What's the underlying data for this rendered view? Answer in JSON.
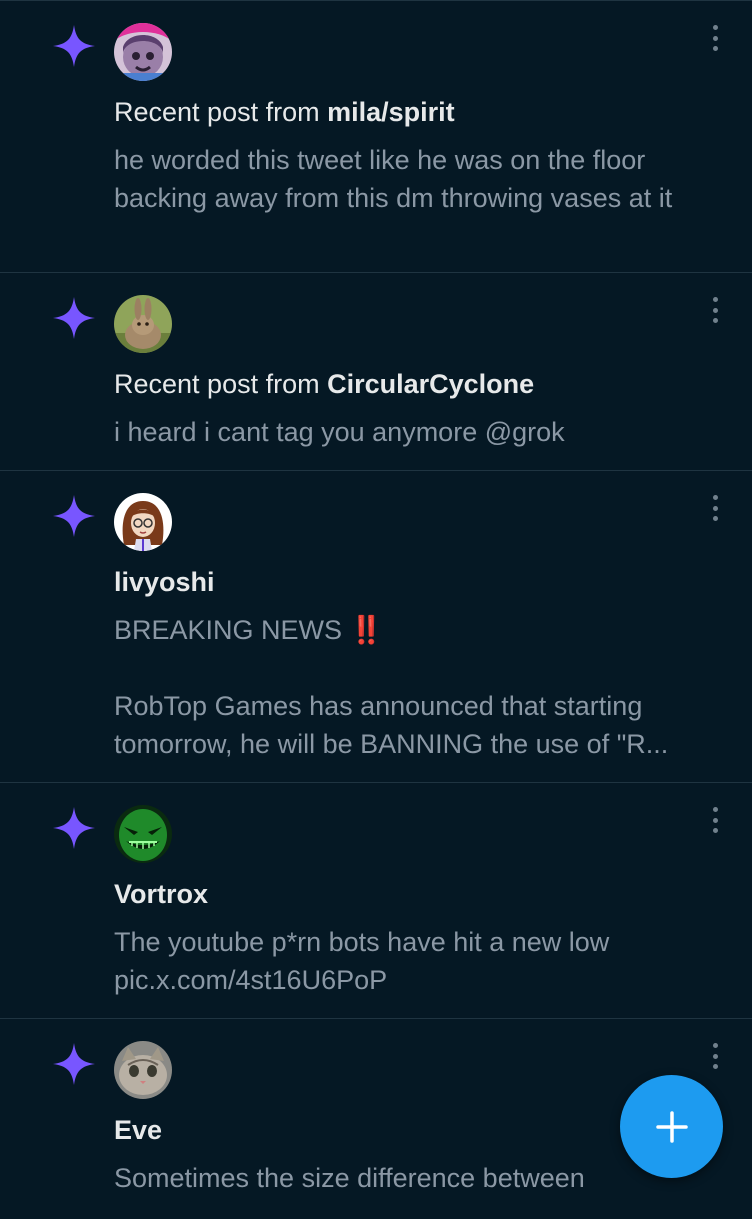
{
  "colors": {
    "background": "#051824",
    "sparkle": "#7856ff",
    "fab": "#1d9bf0",
    "body_text": "#8b98a5",
    "divider": "#1f3441"
  },
  "notifications": [
    {
      "type": "recent_post",
      "prefix": "Recent post from ",
      "author": "mila/spirit",
      "text": "he worded this tweet like he was on the floor backing away from this dm throwing vases at it",
      "avatar": "anime-avatar"
    },
    {
      "type": "recent_post",
      "prefix": "Recent post from ",
      "author": "CircularCyclone",
      "text": "i heard i cant tag you anymore @grok",
      "avatar": "rabbit-avatar"
    },
    {
      "type": "post",
      "author": "livyoshi",
      "text_line1": "BREAKING NEWS",
      "emoji": "‼️",
      "text_line2": "RobTop Games has announced that starting tomorrow, he will be BANNING the use of \"R...",
      "avatar": "cartoon-girl-avatar"
    },
    {
      "type": "post",
      "author": "Vortrox",
      "text": "The youtube p*rn bots have hit a new low",
      "link": "pic.x.com/4st16U6PoP",
      "avatar": "green-grin-avatar"
    },
    {
      "type": "post",
      "author": "Eve",
      "text": "Sometimes the size difference between",
      "avatar": "cat-avatar"
    }
  ],
  "icons": {
    "notification_type": "sparkle-icon",
    "menu": "more-icon",
    "compose": "plus-icon"
  }
}
